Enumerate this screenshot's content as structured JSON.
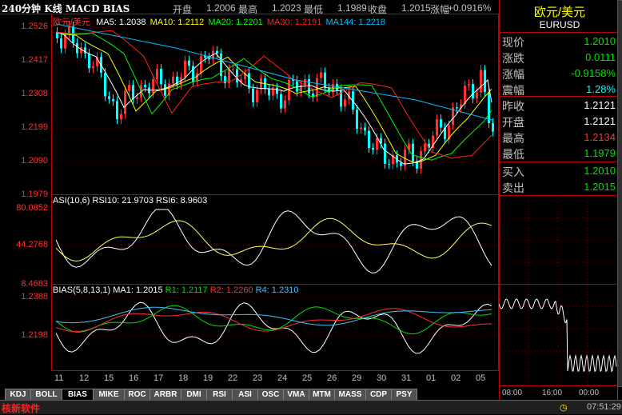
{
  "window": {
    "title": "240分钟 K线 MACD BIAS"
  },
  "quote": {
    "open_label": "开盘",
    "open": "1.2006",
    "high_label": "最高",
    "high": "1.2023",
    "low_label": "最低",
    "low": "1.1989",
    "close_label": "收盘",
    "close": "1.2015",
    "change_label": "涨幅",
    "change": "+0.0916%"
  },
  "main_panel": {
    "symbol": "欧元/美元",
    "ma": [
      {
        "label": "MA5: 1.2038",
        "color": "#ffffff"
      },
      {
        "label": "MA10: 1.2112",
        "color": "#ffff00"
      },
      {
        "label": "MA20: 1.2201",
        "color": "#00ff00"
      },
      {
        "label": "MA30: 1.2191",
        "color": "#ff2020"
      },
      {
        "label": "MA144: 1.2218",
        "color": "#00c0ff"
      }
    ],
    "yticks": [
      "1.2526",
      "1.2417",
      "1.2308",
      "1.2199",
      "1.2090",
      "1.1979"
    ]
  },
  "asi_panel": {
    "title": "ASI(10,6)",
    "rsi10": "RSI10: 21.9703",
    "rsi6": "RSI6: 8.9603",
    "yticks": [
      "80.0852",
      "44.2768",
      "8.4683"
    ]
  },
  "bias_panel": {
    "title": "BIAS(5,8,13,1)",
    "ma1": "MA1: 1.2015",
    "r1": "R1: 1.2117",
    "r2": "R2: 1.2260",
    "r4": "R4: 1.2310",
    "yticks": [
      "1.2388",
      "1.2198"
    ]
  },
  "x_axis": [
    "11",
    "12",
    "15",
    "16",
    "17",
    "18",
    "19",
    "22",
    "23",
    "24",
    "25",
    "26",
    "29",
    "30",
    "31",
    "01",
    "02",
    "05"
  ],
  "tabs": [
    "KDJ",
    "BOLL",
    "BIAS",
    "MIKE",
    "ROC",
    "ARBR",
    "DMI",
    "RSI",
    "ASI",
    "OSC",
    "VMA",
    "MTM",
    "MASS",
    "CDP",
    "PSY"
  ],
  "active_tab": "BIAS",
  "right_panel": {
    "name": "欧元/美元",
    "code": "EURUSD",
    "rows": [
      {
        "label": "现价",
        "value": "1.2010",
        "color": "#00e000"
      },
      {
        "label": "涨跌",
        "value": "0.0111",
        "color": "#00e000"
      },
      {
        "label": "涨幅",
        "value": "-0.9158%",
        "color": "#00e000"
      },
      {
        "label": "震幅",
        "value": "1.28%",
        "color": "#00ffff"
      },
      {
        "label": "昨收",
        "value": "1.2121",
        "color": "#ffffff"
      },
      {
        "label": "开盘",
        "value": "1.2121",
        "color": "#ffffff"
      },
      {
        "label": "最高",
        "value": "1.2134",
        "color": "#ff3030"
      },
      {
        "label": "最低",
        "value": "1.1979",
        "color": "#00e000"
      },
      {
        "label": "买入",
        "value": "1.2010",
        "color": "#00e000"
      },
      {
        "label": "卖出",
        "value": "1.2015",
        "color": "#00e000"
      }
    ],
    "mini_times": [
      "08:00",
      "16:00",
      "00:00"
    ]
  },
  "status": {
    "brand": "核新软件",
    "time": "07:51:29"
  }
}
